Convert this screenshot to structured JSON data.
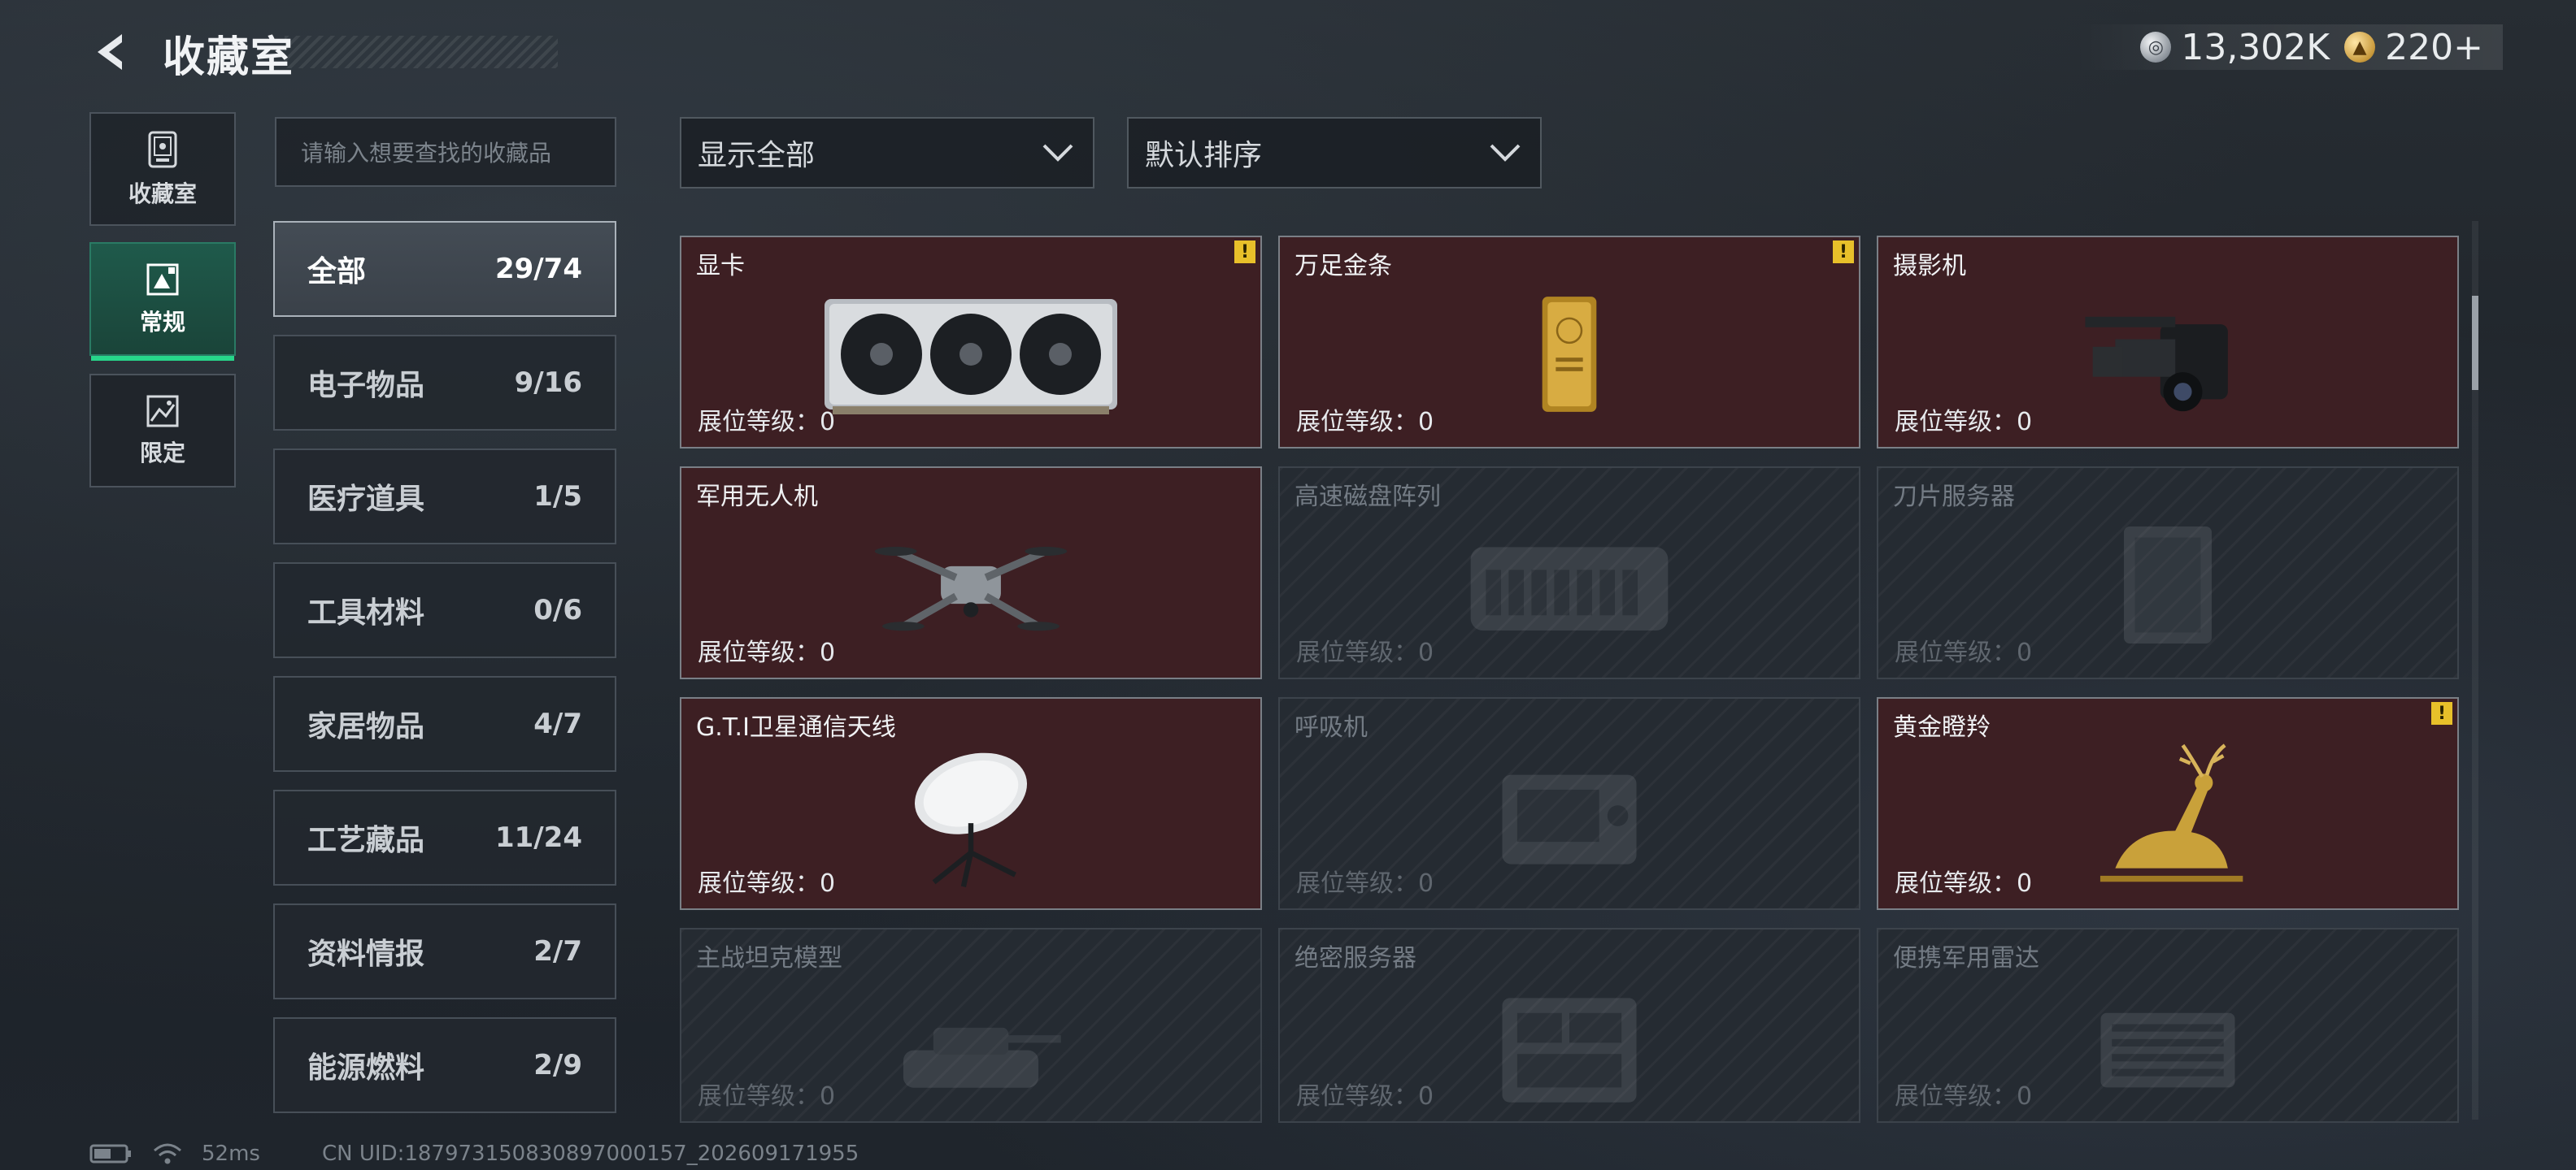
{
  "header": {
    "title": "收藏室"
  },
  "currency": {
    "silver": {
      "icon": "silver-coin-icon",
      "value": "13,302K"
    },
    "gold": {
      "icon": "gold-coin-icon",
      "value": "220+"
    }
  },
  "rail": [
    {
      "label": "收藏室",
      "icon": "collection-room-icon",
      "active": false
    },
    {
      "label": "常规",
      "icon": "regular-gallery-icon",
      "active": true
    },
    {
      "label": "限定",
      "icon": "limited-gallery-icon",
      "active": false
    }
  ],
  "search": {
    "placeholder": "请输入想要查找的收藏品"
  },
  "categories": [
    {
      "name": "全部",
      "count": "29/74",
      "active": true
    },
    {
      "name": "电子物品",
      "count": "9/16"
    },
    {
      "name": "医疗道具",
      "count": "1/5"
    },
    {
      "name": "工具材料",
      "count": "0/6"
    },
    {
      "name": "家居物品",
      "count": "4/7"
    },
    {
      "name": "工艺藏品",
      "count": "11/24"
    },
    {
      "name": "资料情报",
      "count": "2/7"
    },
    {
      "name": "能源燃料",
      "count": "2/9"
    }
  ],
  "filters": {
    "display": "显示全部",
    "sort": "默认排序"
  },
  "items": [
    {
      "name": "显卡",
      "level": "展位等级：0",
      "owned": true,
      "alert": true,
      "alert_text": "!",
      "art": "gpu"
    },
    {
      "name": "万足金条",
      "level": "展位等级：0",
      "owned": true,
      "alert": true,
      "alert_text": "!",
      "art": "goldbar"
    },
    {
      "name": "摄影机",
      "level": "展位等级：0",
      "owned": true,
      "alert": false,
      "art": "camera"
    },
    {
      "name": "军用无人机",
      "level": "展位等级：0",
      "owned": true,
      "alert": false,
      "art": "drone"
    },
    {
      "name": "高速磁盘阵列",
      "level": "展位等级：0",
      "owned": false,
      "alert": false,
      "art": "disk"
    },
    {
      "name": "刀片服务器",
      "level": "展位等级：0",
      "owned": false,
      "alert": false,
      "art": "blade"
    },
    {
      "name": "G.T.I卫星通信天线",
      "level": "展位等级：0",
      "owned": true,
      "alert": false,
      "art": "dish"
    },
    {
      "name": "呼吸机",
      "level": "展位等级：0",
      "owned": false,
      "alert": false,
      "art": "ventilator"
    },
    {
      "name": "黄金瞪羚",
      "level": "展位等级：0",
      "owned": true,
      "alert": true,
      "alert_text": "!",
      "art": "gazelle"
    },
    {
      "name": "主战坦克模型",
      "level": "展位等级：0",
      "owned": false,
      "alert": false,
      "art": "tank"
    },
    {
      "name": "绝密服务器",
      "level": "展位等级：0",
      "owned": false,
      "alert": false,
      "art": "server"
    },
    {
      "name": "便携军用雷达",
      "level": "展位等级：0",
      "owned": false,
      "alert": false,
      "art": "radar"
    }
  ],
  "footer": {
    "ping": "52ms",
    "uid": "CN UID:18797315083089700015​7_202609171955"
  }
}
